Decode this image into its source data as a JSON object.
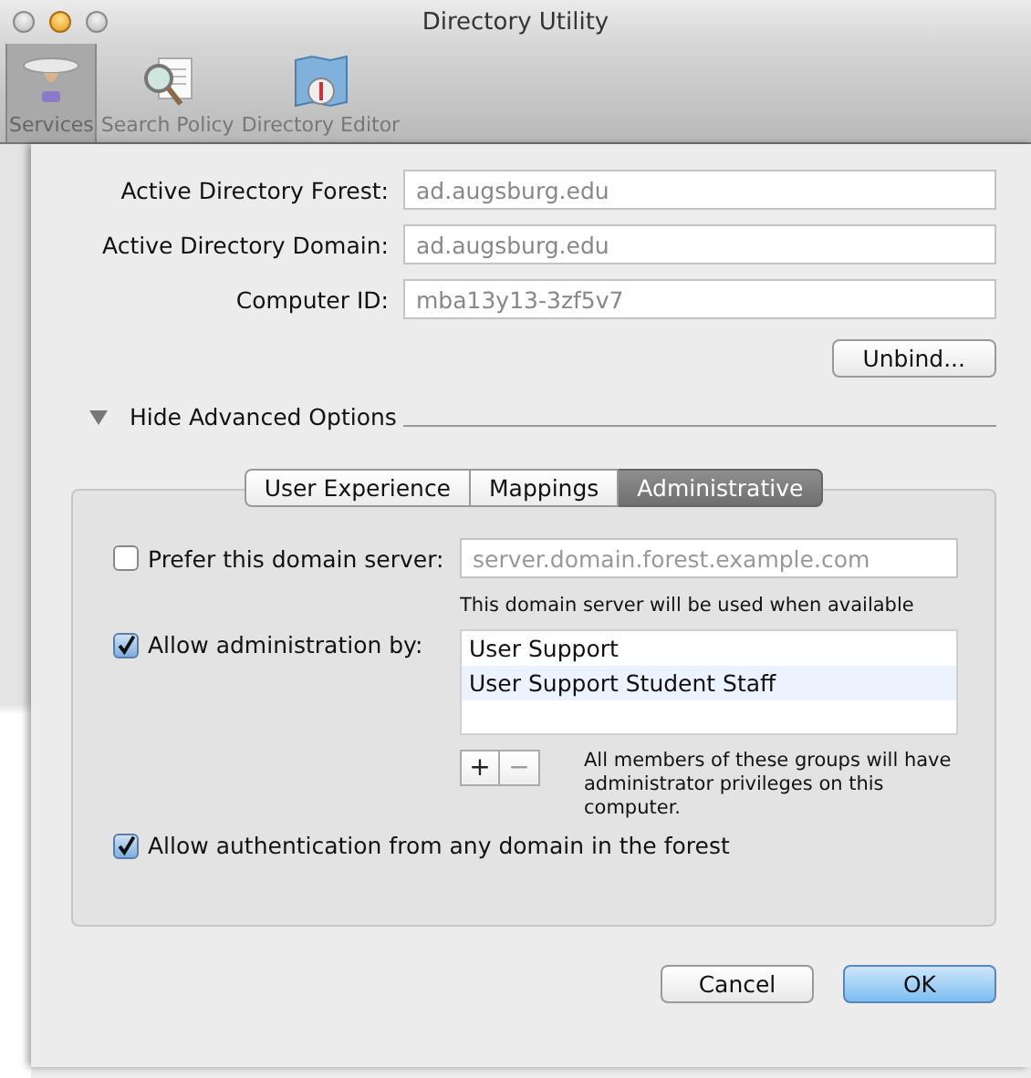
{
  "window": {
    "title": "Directory Utility"
  },
  "toolbar": [
    {
      "label": "Services",
      "selected": true,
      "kind": "tray"
    },
    {
      "label": "Search Policy",
      "selected": false,
      "kind": "magnifier"
    },
    {
      "label": "Directory Editor",
      "selected": false,
      "kind": "map"
    }
  ],
  "fields": [
    {
      "label": "Active Directory Forest:",
      "value": "ad.augsburg.edu"
    },
    {
      "label": "Active Directory Domain:",
      "value": "ad.augsburg.edu"
    },
    {
      "label": "Computer ID:",
      "value": "mba13y13-3zf5v7"
    }
  ],
  "unbind_button": "Unbind...",
  "disclosure": {
    "label": "Hide Advanced Options",
    "expanded": true
  },
  "tabs": [
    {
      "label": "User Experience",
      "selected": false
    },
    {
      "label": "Mappings",
      "selected": false
    },
    {
      "label": "Administrative",
      "selected": true
    }
  ],
  "prefer_server": {
    "label": "Prefer this domain server:",
    "checked": false,
    "placeholder": "server.domain.forest.example.com",
    "hint": "This domain server will be used when available"
  },
  "allow_admin": {
    "label": "Allow administration by:",
    "checked": true,
    "groups": [
      "User Support",
      "User Support Student Staff"
    ],
    "add_button": "+",
    "remove_button": "−",
    "description": "All members of these groups will have administrator privileges on this computer."
  },
  "allow_auth": {
    "label": "Allow authentication from any domain in the forest",
    "checked": true
  },
  "buttons": [
    {
      "label": "Cancel",
      "kind": "normal"
    },
    {
      "label": "OK",
      "kind": "default"
    }
  ]
}
